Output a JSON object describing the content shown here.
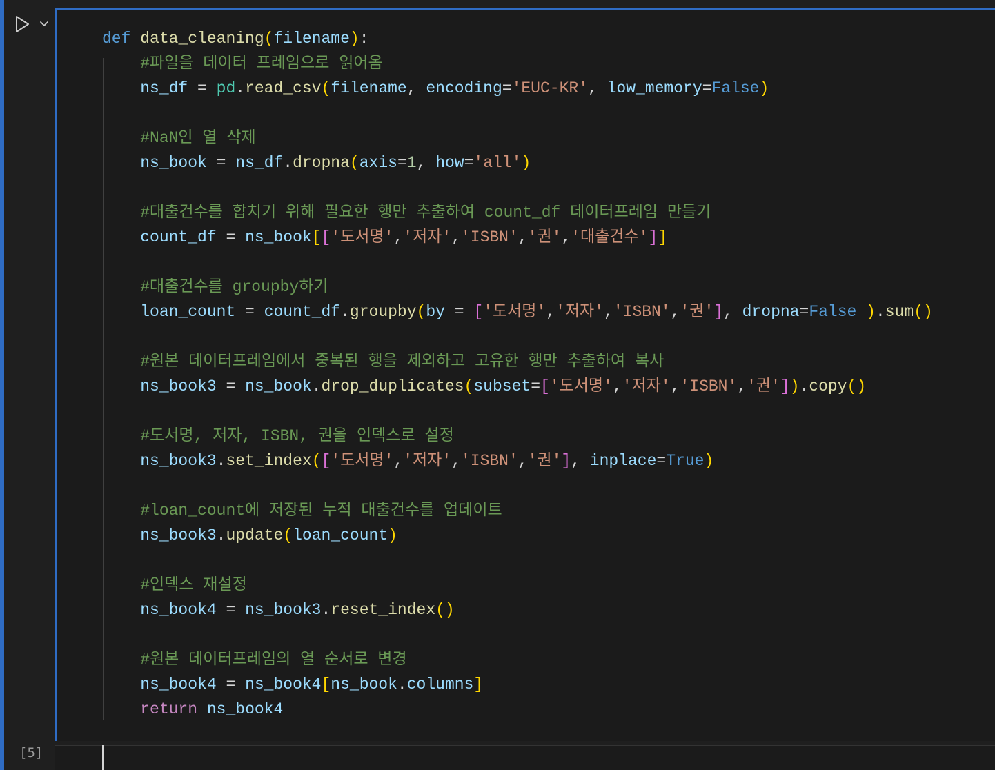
{
  "cell": {
    "execution_count": "[5]",
    "run_icon": "play-icon",
    "menu_icon": "chevron-down-icon"
  },
  "code": {
    "l01": {
      "kw": "def",
      "fn": "data_cleaning",
      "param": "filename"
    },
    "l02": "#파일을 데이터 프레임으로 읽어옴",
    "l03": {
      "var": "ns_df",
      "mod": "pd",
      "fn": "read_csv",
      "arg1": "filename",
      "kw1": "encoding",
      "str1": "'EUC-KR'",
      "kw2": "low_memory",
      "bool1": "False"
    },
    "l05": "#NaN인 열 삭제",
    "l06": {
      "var": "ns_book",
      "obj": "ns_df",
      "fn": "dropna",
      "kw1": "axis",
      "num1": "1",
      "kw2": "how",
      "str1": "'all'"
    },
    "l08": "#대출건수를 합치기 위해 필요한 행만 추출하여 count_df 데이터프레임 만들기",
    "l09": {
      "var": "count_df",
      "obj": "ns_book",
      "s1": "'도서명'",
      "s2": "'저자'",
      "s3": "'ISBN'",
      "s4": "'권'",
      "s5": "'대출건수'"
    },
    "l11": "#대출건수를 groupby하기",
    "l12": {
      "var": "loan_count",
      "obj": "count_df",
      "fn": "groupby",
      "kw1": "by",
      "s1": "'도서명'",
      "s2": "'저자'",
      "s3": "'ISBN'",
      "s4": "'권'",
      "kw2": "dropna",
      "bool1": "False",
      "fn2": "sum"
    },
    "l14": "#원본 데이터프레임에서 중복된 행을 제외하고 고유한 행만 추출하여 복사",
    "l15": {
      "var": "ns_book3",
      "obj": "ns_book",
      "fn": "drop_duplicates",
      "kw1": "subset",
      "s1": "'도서명'",
      "s2": "'저자'",
      "s3": "'ISBN'",
      "s4": "'권'",
      "fn2": "copy"
    },
    "l17": "#도서명, 저자, ISBN, 권을 인덱스로 설정",
    "l18": {
      "obj": "ns_book3",
      "fn": "set_index",
      "s1": "'도서명'",
      "s2": "'저자'",
      "s3": "'ISBN'",
      "s4": "'권'",
      "kw1": "inplace",
      "bool1": "True"
    },
    "l20": "#loan_count에 저장된 누적 대출건수를 업데이트",
    "l21": {
      "obj": "ns_book3",
      "fn": "update",
      "arg1": "loan_count"
    },
    "l23": "#인덱스 재설정",
    "l24": {
      "var": "ns_book4",
      "obj": "ns_book3",
      "fn": "reset_index"
    },
    "l26": "#원본 데이터프레임의 열 순서로 변경",
    "l27": {
      "var": "ns_book4",
      "obj": "ns_book4",
      "obj2": "ns_book",
      "attr": "columns"
    },
    "l28": {
      "kw": "return",
      "var": "ns_book4"
    }
  },
  "colors": {
    "accent": "#2f6cc4",
    "keyword": "#569cd6",
    "function": "#dcdcaa",
    "variable": "#9cdcfe",
    "string": "#ce9178",
    "comment": "#6a9955",
    "module": "#4ec9b0"
  }
}
